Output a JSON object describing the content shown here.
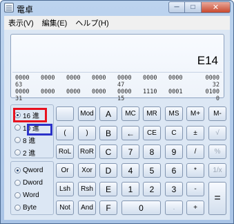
{
  "window": {
    "title": "電卓"
  },
  "caption": {
    "minimize": "─",
    "maximize": "□",
    "close": "✕"
  },
  "menu": [
    "表示(V)",
    "編集(E)",
    "ヘルプ(H)"
  ],
  "display": {
    "value": "E14",
    "bits": [
      [
        "0000",
        "0000",
        "0000",
        "0000",
        "0000",
        "0000",
        "0000",
        "0000"
      ],
      [
        "63",
        "",
        "",
        "",
        "47",
        "",
        "",
        "32"
      ],
      [
        "0000",
        "0000",
        "0000",
        "0000",
        "0000",
        "1110",
        "0001",
        "0100"
      ],
      [
        "31",
        "",
        "",
        "",
        "15",
        "",
        "",
        "0"
      ]
    ]
  },
  "radix": [
    {
      "label": "16 進",
      "checked": true
    },
    {
      "label": "10 進",
      "checked": false
    },
    {
      "label": "8 進",
      "checked": false
    },
    {
      "label": "2 進",
      "checked": false
    }
  ],
  "word_size": [
    {
      "label": "Qword",
      "checked": true
    },
    {
      "label": "Dword",
      "checked": false
    },
    {
      "label": "Word",
      "checked": false
    },
    {
      "label": "Byte",
      "checked": false
    }
  ],
  "keys": {
    "r1": [
      "",
      "Mod",
      "A",
      "MC",
      "MR",
      "MS",
      "M+",
      "M-"
    ],
    "r2": [
      "(",
      ")",
      "B",
      "←",
      "CE",
      "C",
      "±",
      "√"
    ],
    "r3": [
      "RoL",
      "RoR",
      "C",
      "7",
      "8",
      "9",
      "/",
      "%"
    ],
    "r4": [
      "Or",
      "Xor",
      "D",
      "4",
      "5",
      "6",
      "*",
      "1/x"
    ],
    "r5": [
      "Lsh",
      "Rsh",
      "E",
      "1",
      "2",
      "3",
      "-",
      "="
    ],
    "r6": [
      "Not",
      "And",
      "F",
      "0",
      ".",
      "+"
    ]
  },
  "highlight_colors": {
    "red": "#e8101e",
    "blue": "#2b32c8"
  }
}
